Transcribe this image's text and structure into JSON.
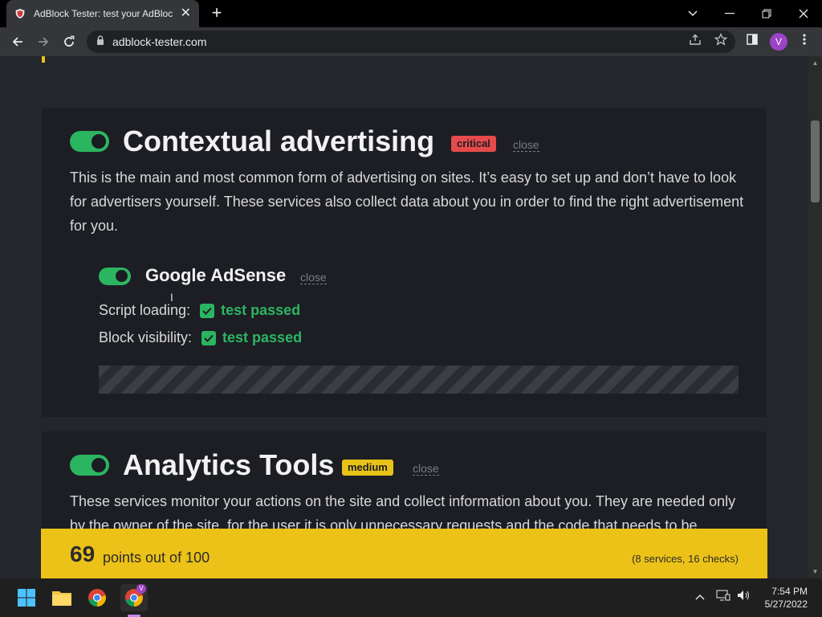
{
  "browser": {
    "tab_title": "AdBlock Tester: test your AdBlock",
    "url": "adblock-tester.com",
    "profile_initial": "V"
  },
  "page": {
    "sections": [
      {
        "title": "Contextual advertising",
        "badge": "critical",
        "close_label": "close",
        "toggle_on": true,
        "description": "This is the main and most common form of advertising on sites. It’s easy to set up and don’t have to look for advertisers yourself. These services also collect data about you in order to find the right advertisement for you.",
        "services": [
          {
            "name": "Google AdSense",
            "close_label": "close",
            "toggle_on": true,
            "checks": [
              {
                "label": "Script loading:",
                "result": "test passed"
              },
              {
                "label": "Block visibility:",
                "result": "test passed"
              }
            ]
          }
        ]
      },
      {
        "title": "Analytics Tools",
        "badge": "medium",
        "close_label": "close",
        "toggle_on": true,
        "description": "These services monitor your actions on the site and collect information about you. They are needed only by the owner of the site, for the user it is only unnecessary requests and the code that needs to be"
      }
    ],
    "score": {
      "points": "69",
      "points_label": "points out of 100",
      "summary": "(8 services, 16 checks)"
    }
  },
  "taskbar": {
    "time": "7:54 PM",
    "date": "5/27/2022"
  },
  "colors": {
    "accent_green": "#2cb561",
    "badge_critical": "#e54b4b",
    "badge_medium": "#e8c217",
    "score_bar": "#ecc218",
    "page_bg": "#23262c",
    "card_bg": "#1c1e24"
  }
}
